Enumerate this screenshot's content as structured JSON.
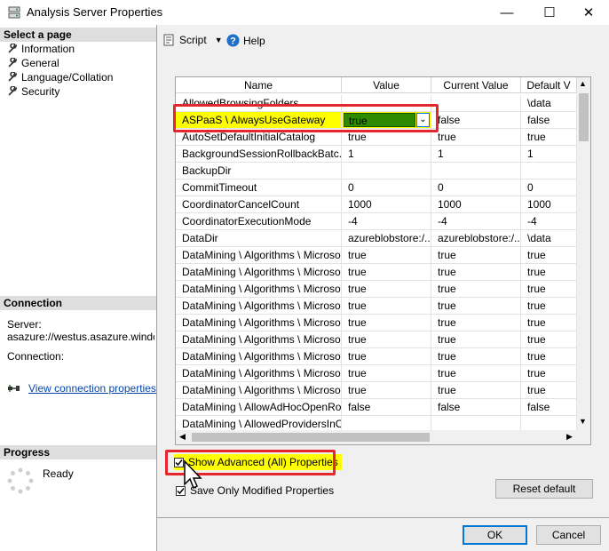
{
  "window": {
    "title": "Analysis Server Properties",
    "minimize_icon": "minimize-icon",
    "maximize_icon": "maximize-icon",
    "close_icon": "close-icon"
  },
  "left_pane": {
    "select_page_header": "Select a page",
    "pages": [
      {
        "label": "Information"
      },
      {
        "label": "General"
      },
      {
        "label": "Language/Collation"
      },
      {
        "label": "Security"
      }
    ],
    "connection_header": "Connection",
    "server_label": "Server:",
    "server_value": "asazure://westus.asazure.windows",
    "connection_label": "Connection:",
    "view_connection_link": "View connection properties",
    "progress_header": "Progress",
    "progress_status": "Ready"
  },
  "toolbar": {
    "script_label": "Script",
    "help_label": "Help"
  },
  "grid": {
    "columns": [
      "Name",
      "Value",
      "Current Value",
      "Default V"
    ],
    "rows": [
      {
        "name": "AllowedBrowsingFolders",
        "value": "",
        "current": "",
        "default": "\\data"
      },
      {
        "name": "ASPaaS \\ AlwaysUseGateway",
        "value": "true",
        "current": "false",
        "default": "false"
      },
      {
        "name": "AutoSetDefaultInitialCatalog",
        "value": "true",
        "current": "true",
        "default": "true"
      },
      {
        "name": "BackgroundSessionRollbackBatc...",
        "value": "1",
        "current": "1",
        "default": "1"
      },
      {
        "name": "BackupDir",
        "value": "",
        "current": "",
        "default": ""
      },
      {
        "name": "CommitTimeout",
        "value": "0",
        "current": "0",
        "default": "0"
      },
      {
        "name": "CoordinatorCancelCount",
        "value": "1000",
        "current": "1000",
        "default": "1000"
      },
      {
        "name": "CoordinatorExecutionMode",
        "value": "-4",
        "current": "-4",
        "default": "-4"
      },
      {
        "name": "DataDir",
        "value": "azureblobstore:/...",
        "current": "azureblobstore:/...",
        "default": "\\data"
      },
      {
        "name": "DataMining \\ Algorithms \\ Microso...",
        "value": "true",
        "current": "true",
        "default": "true"
      },
      {
        "name": "DataMining \\ Algorithms \\ Microso...",
        "value": "true",
        "current": "true",
        "default": "true"
      },
      {
        "name": "DataMining \\ Algorithms \\ Microso...",
        "value": "true",
        "current": "true",
        "default": "true"
      },
      {
        "name": "DataMining \\ Algorithms \\ Microso...",
        "value": "true",
        "current": "true",
        "default": "true"
      },
      {
        "name": "DataMining \\ Algorithms \\ Microso...",
        "value": "true",
        "current": "true",
        "default": "true"
      },
      {
        "name": "DataMining \\ Algorithms \\ Microso...",
        "value": "true",
        "current": "true",
        "default": "true"
      },
      {
        "name": "DataMining \\ Algorithms \\ Microso...",
        "value": "true",
        "current": "true",
        "default": "true"
      },
      {
        "name": "DataMining \\ Algorithms \\ Microso...",
        "value": "true",
        "current": "true",
        "default": "true"
      },
      {
        "name": "DataMining \\ Algorithms \\ Microso...",
        "value": "true",
        "current": "true",
        "default": "true"
      },
      {
        "name": "DataMining \\ AllowAdHocOpenRo...",
        "value": "false",
        "current": "false",
        "default": "false"
      },
      {
        "name": "DataMining \\ AllowedProvidersInO...",
        "value": "",
        "current": "",
        "default": ""
      }
    ]
  },
  "options": {
    "show_advanced_label": "Show Advanced (All) Properties",
    "show_advanced_checked": true,
    "save_modified_label": "Save Only Modified Properties",
    "save_modified_checked": true
  },
  "buttons": {
    "reset_default": "Reset default",
    "ok": "OK",
    "cancel": "Cancel"
  },
  "colors": {
    "highlight_yellow": "#ffff00",
    "annotation_red": "#e5262c",
    "dropdown_green": "#2e8b00",
    "link_blue": "#0645ad"
  }
}
